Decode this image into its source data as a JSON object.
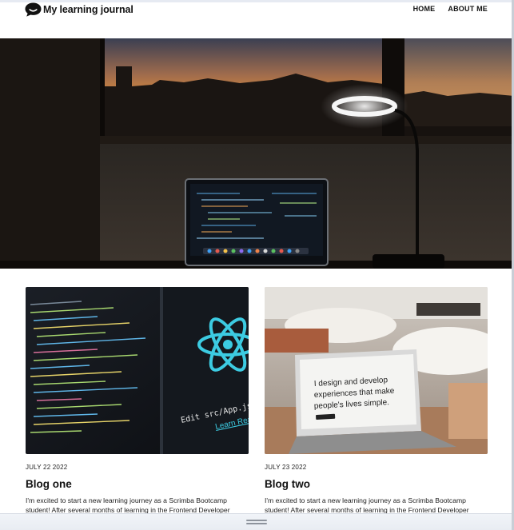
{
  "header": {
    "brand_title": "My learning journal",
    "nav": [
      {
        "label": "HOME"
      },
      {
        "label": "ABOUT ME"
      }
    ]
  },
  "hero": {
    "laptop_code_image": true
  },
  "posts": [
    {
      "date": "JULY 22 2022",
      "title": "Blog one",
      "excerpt": "I'm excited to start a new learning journey as a Scrimba Bootcamp student! After several months of learning in the Frontend Developer",
      "thumb_text_1": "Edit src/App.js and save",
      "thumb_text_2": "Learn React"
    },
    {
      "date": "JULY 23 2022",
      "title": "Blog two",
      "excerpt": "I'm excited to start a new learning journey as a Scrimba Bootcamp student! After several months of learning in the Frontend Developer",
      "thumb_text_1": "I design and develop",
      "thumb_text_2": "experiences that make",
      "thumb_text_3": "people's lives simple."
    }
  ],
  "colors": {
    "text": "#111111",
    "sunset": "#e8923a",
    "react": "#3ccbe2"
  }
}
